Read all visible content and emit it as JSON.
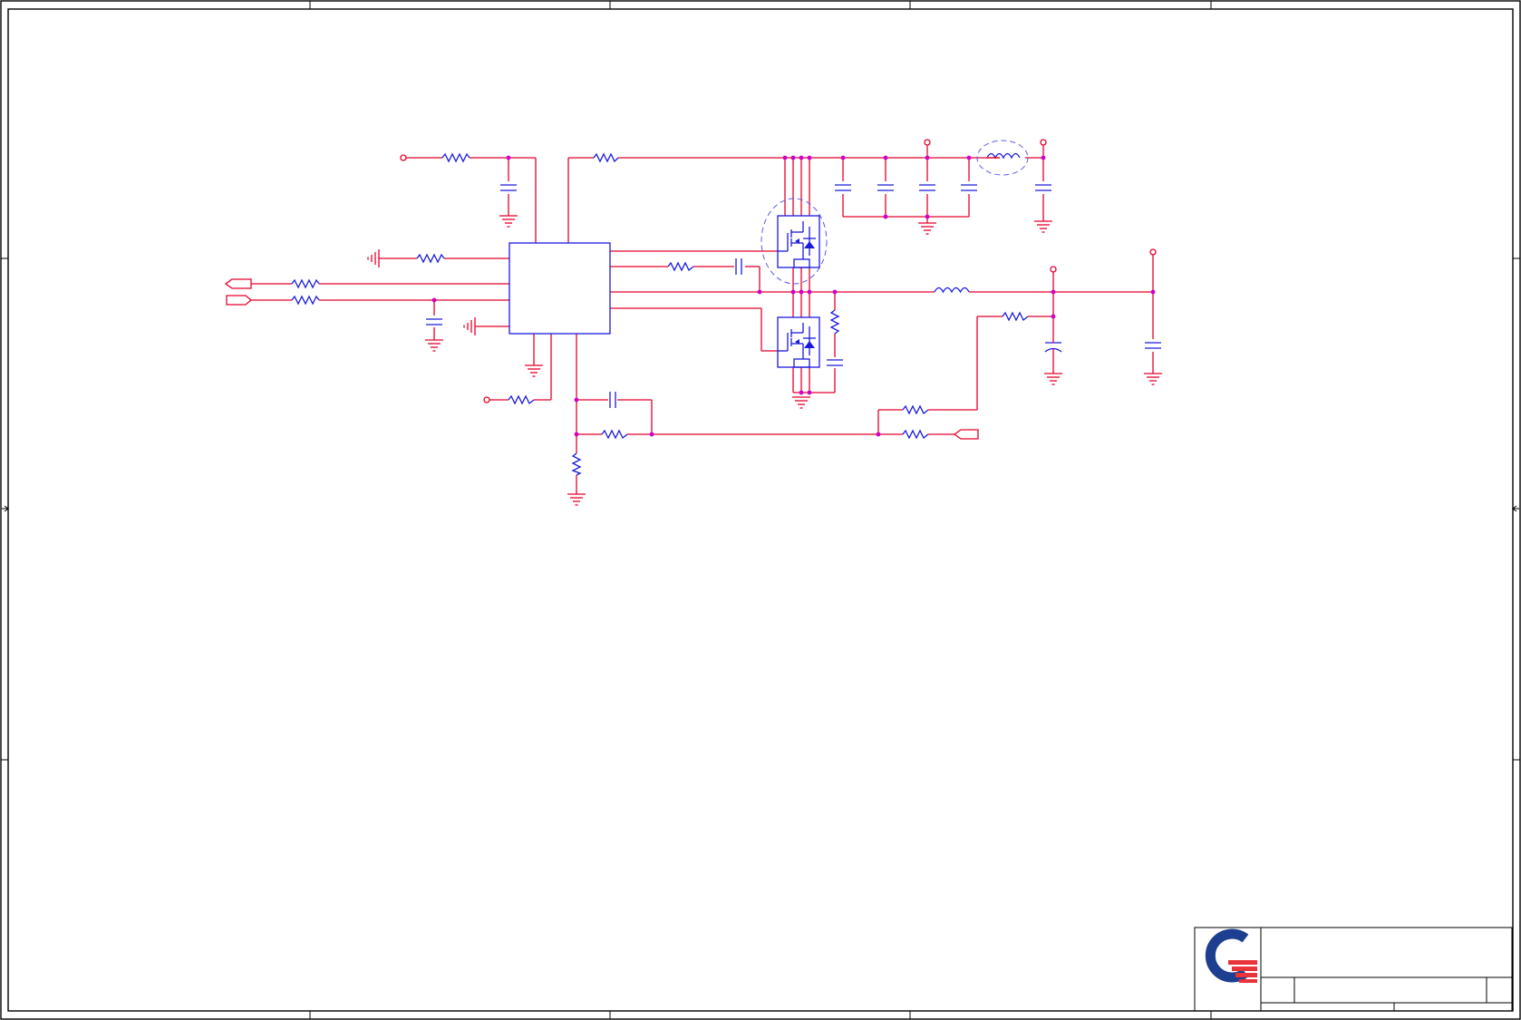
{
  "sheet": {
    "width": 1678,
    "height": 1125,
    "zones": []
  },
  "title_block": {
    "logo": {
      "name": "company-logo",
      "colors": {
        "ring": "#1d3f8f",
        "stripes": "#e8333a"
      }
    },
    "fields": {
      "title": "",
      "doc_number": "",
      "rev": "",
      "date": "",
      "sheet": ""
    }
  },
  "colors": {
    "wire": "#e8002a",
    "component": "#1a1adf",
    "junction": "#d000c8",
    "border": "#000000",
    "highlight": "#5a5aee"
  },
  "components": {
    "controller_ic": {
      "name": "buck-controller-ic",
      "icon": "rectangle"
    },
    "high_side_fet": {
      "name": "high-side-mosfet",
      "icon": "mosfet-with-diode",
      "highlighted": true
    },
    "low_side_fet": {
      "name": "low-side-mosfet",
      "icon": "mosfet-with-diode"
    },
    "input_inductor": {
      "name": "input-inductor",
      "icon": "inductor",
      "highlighted": true
    },
    "output_inductor": {
      "name": "output-inductor",
      "icon": "inductor"
    },
    "output_cap": {
      "name": "output-polarized-capacitor",
      "icon": "polarized-capacitor"
    },
    "ports": [
      "input-port-1",
      "input-port-2",
      "feedback-port"
    ]
  }
}
